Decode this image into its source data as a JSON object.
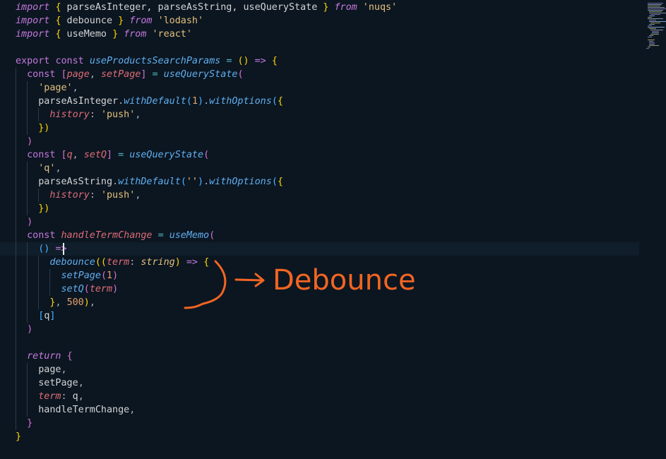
{
  "code_lines": [
    [
      [
        "kw",
        "import"
      ],
      [
        "pun",
        " "
      ],
      [
        "b1",
        "{"
      ],
      [
        "id",
        " parseAsInteger, parseAsString, useQueryState "
      ],
      [
        "b1",
        "}"
      ],
      [
        "pun",
        " "
      ],
      [
        "kw",
        "from"
      ],
      [
        "pun",
        " "
      ],
      [
        "str",
        "'nuqs'"
      ]
    ],
    [
      [
        "kw",
        "import"
      ],
      [
        "pun",
        " "
      ],
      [
        "b1",
        "{"
      ],
      [
        "id",
        " debounce "
      ],
      [
        "b1",
        "}"
      ],
      [
        "pun",
        " "
      ],
      [
        "kw",
        "from"
      ],
      [
        "pun",
        " "
      ],
      [
        "str",
        "'lodash'"
      ]
    ],
    [
      [
        "kw",
        "import"
      ],
      [
        "pun",
        " "
      ],
      [
        "b1",
        "{"
      ],
      [
        "id",
        " useMemo "
      ],
      [
        "b1",
        "}"
      ],
      [
        "pun",
        " "
      ],
      [
        "kw",
        "from"
      ],
      [
        "pun",
        " "
      ],
      [
        "str",
        "'react'"
      ]
    ],
    [],
    [
      [
        "kw2",
        "export"
      ],
      [
        "pun",
        " "
      ],
      [
        "kw2",
        "const"
      ],
      [
        "pun",
        " "
      ],
      [
        "fn",
        "useProductsSearchParams"
      ],
      [
        "pun",
        " "
      ],
      [
        "op",
        "="
      ],
      [
        "pun",
        " "
      ],
      [
        "b1",
        "()"
      ],
      [
        "pun",
        " "
      ],
      [
        "kw2",
        "=>"
      ],
      [
        "pun",
        " "
      ],
      [
        "b1",
        "{"
      ]
    ],
    [
      [
        "pun",
        "  "
      ],
      [
        "kw2",
        "const"
      ],
      [
        "pun",
        " "
      ],
      [
        "b2",
        "["
      ],
      [
        "var",
        "page"
      ],
      [
        "pun",
        ", "
      ],
      [
        "var",
        "setPage"
      ],
      [
        "b2",
        "]"
      ],
      [
        "pun",
        " "
      ],
      [
        "op",
        "="
      ],
      [
        "pun",
        " "
      ],
      [
        "fn",
        "useQueryState"
      ],
      [
        "b2",
        "("
      ]
    ],
    [
      [
        "pun",
        "    "
      ],
      [
        "str",
        "'page'"
      ],
      [
        "pun",
        ","
      ]
    ],
    [
      [
        "pun",
        "    "
      ],
      [
        "id",
        "parseAsInteger"
      ],
      [
        "pun",
        "."
      ],
      [
        "fn",
        "withDefault"
      ],
      [
        "b3",
        "("
      ],
      [
        "num",
        "1"
      ],
      [
        "b3",
        ")"
      ],
      [
        "pun",
        "."
      ],
      [
        "fn",
        "withOptions"
      ],
      [
        "b3",
        "("
      ],
      [
        "b1",
        "{"
      ]
    ],
    [
      [
        "pun",
        "      "
      ],
      [
        "prop",
        "history"
      ],
      [
        "pun",
        ": "
      ],
      [
        "str",
        "'push'"
      ],
      [
        "pun",
        ","
      ]
    ],
    [
      [
        "pun",
        "    "
      ],
      [
        "b1",
        "})"
      ]
    ],
    [
      [
        "pun",
        "  "
      ],
      [
        "b2",
        ")"
      ]
    ],
    [
      [
        "pun",
        "  "
      ],
      [
        "kw2",
        "const"
      ],
      [
        "pun",
        " "
      ],
      [
        "b2",
        "["
      ],
      [
        "var",
        "q"
      ],
      [
        "pun",
        ", "
      ],
      [
        "var",
        "setQ"
      ],
      [
        "b2",
        "]"
      ],
      [
        "pun",
        " "
      ],
      [
        "op",
        "="
      ],
      [
        "pun",
        " "
      ],
      [
        "fn",
        "useQueryState"
      ],
      [
        "b2",
        "("
      ]
    ],
    [
      [
        "pun",
        "    "
      ],
      [
        "str",
        "'q'"
      ],
      [
        "pun",
        ","
      ]
    ],
    [
      [
        "pun",
        "    "
      ],
      [
        "id",
        "parseAsString"
      ],
      [
        "pun",
        "."
      ],
      [
        "fn",
        "withDefault"
      ],
      [
        "b3",
        "("
      ],
      [
        "str",
        "''"
      ],
      [
        "b3",
        ")"
      ],
      [
        "pun",
        "."
      ],
      [
        "fn",
        "withOptions"
      ],
      [
        "b3",
        "("
      ],
      [
        "b1",
        "{"
      ]
    ],
    [
      [
        "pun",
        "      "
      ],
      [
        "prop",
        "history"
      ],
      [
        "pun",
        ": "
      ],
      [
        "str",
        "'push'"
      ],
      [
        "pun",
        ","
      ]
    ],
    [
      [
        "pun",
        "    "
      ],
      [
        "b1",
        "})"
      ]
    ],
    [
      [
        "pun",
        "  "
      ],
      [
        "b2",
        ")"
      ]
    ],
    [
      [
        "pun",
        "  "
      ],
      [
        "kw2",
        "const"
      ],
      [
        "pun",
        " "
      ],
      [
        "var",
        "handleTermChange"
      ],
      [
        "pun",
        " "
      ],
      [
        "op",
        "="
      ],
      [
        "pun",
        " "
      ],
      [
        "fn",
        "useMemo"
      ],
      [
        "b2",
        "("
      ]
    ],
    [
      [
        "pun",
        "    "
      ],
      [
        "b3",
        "()"
      ],
      [
        "pun",
        " "
      ],
      [
        "kw2",
        "=>"
      ]
    ],
    [
      [
        "pun",
        "      "
      ],
      [
        "fn",
        "debounce"
      ],
      [
        "b1",
        "(("
      ],
      [
        "var",
        "term"
      ],
      [
        "pun",
        ": "
      ],
      [
        "type",
        "string"
      ],
      [
        "b1",
        ")"
      ],
      [
        "pun",
        " "
      ],
      [
        "kw2",
        "=>"
      ],
      [
        "pun",
        " "
      ],
      [
        "b1",
        "{"
      ]
    ],
    [
      [
        "pun",
        "        "
      ],
      [
        "fn",
        "setPage"
      ],
      [
        "b2",
        "("
      ],
      [
        "num",
        "1"
      ],
      [
        "b2",
        ")"
      ]
    ],
    [
      [
        "pun",
        "        "
      ],
      [
        "fn",
        "setQ"
      ],
      [
        "b2",
        "("
      ],
      [
        "var",
        "term"
      ],
      [
        "b2",
        ")"
      ]
    ],
    [
      [
        "pun",
        "      "
      ],
      [
        "b1",
        "}"
      ],
      [
        "pun",
        ", "
      ],
      [
        "num",
        "500"
      ],
      [
        "b1",
        ")"
      ],
      [
        "pun",
        ","
      ]
    ],
    [
      [
        "pun",
        "    "
      ],
      [
        "b3",
        "["
      ],
      [
        "id",
        "q"
      ],
      [
        "b3",
        "]"
      ]
    ],
    [
      [
        "pun",
        "  "
      ],
      [
        "b2",
        ")"
      ]
    ],
    [],
    [
      [
        "pun",
        "  "
      ],
      [
        "kw",
        "return"
      ],
      [
        "pun",
        " "
      ],
      [
        "b2",
        "{"
      ]
    ],
    [
      [
        "pun",
        "    "
      ],
      [
        "id",
        "page"
      ],
      [
        "pun",
        ","
      ]
    ],
    [
      [
        "pun",
        "    "
      ],
      [
        "id",
        "setPage"
      ],
      [
        "pun",
        ","
      ]
    ],
    [
      [
        "pun",
        "    "
      ],
      [
        "prop",
        "term"
      ],
      [
        "pun",
        ": "
      ],
      [
        "id",
        "q"
      ],
      [
        "pun",
        ","
      ]
    ],
    [
      [
        "pun",
        "    "
      ],
      [
        "id",
        "handleTermChange"
      ],
      [
        "pun",
        ","
      ]
    ],
    [
      [
        "pun",
        "  "
      ],
      [
        "b2",
        "}"
      ]
    ],
    [
      [
        "b1",
        "}"
      ]
    ]
  ],
  "annotation": {
    "label": "Debounce",
    "color": "#f26522"
  },
  "colors": {
    "background": "#0b1621",
    "active_line": "#0f1e2a"
  }
}
